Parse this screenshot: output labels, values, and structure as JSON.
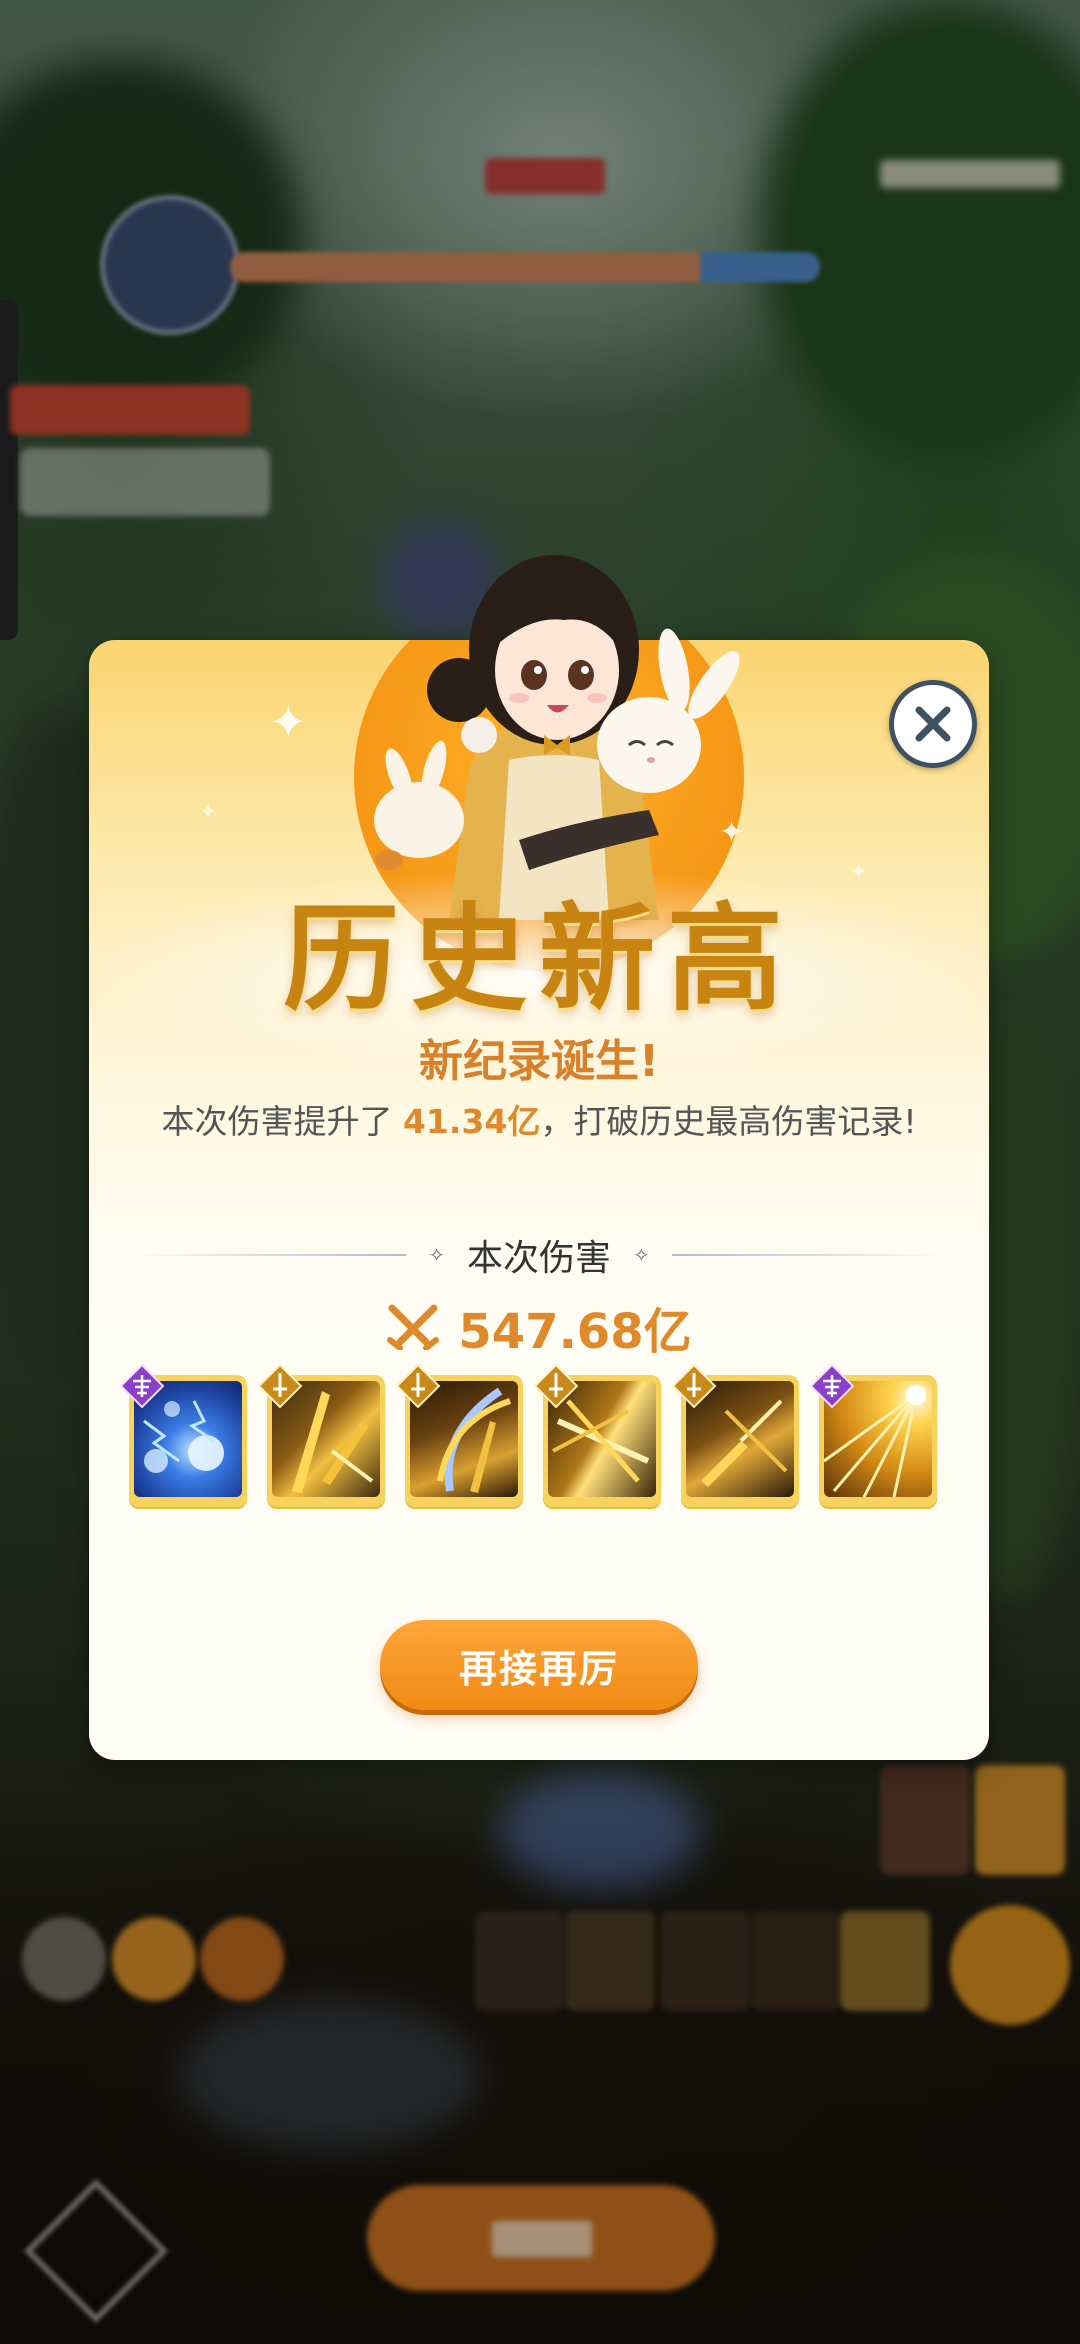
{
  "popup": {
    "title": "历史新高",
    "subtitle": "新纪录诞生!",
    "desc_prefix": "本次伤害提升了 ",
    "desc_value": "41.34亿",
    "desc_suffix": "，打破历史最高伤害记录!",
    "section_label": "本次伤害",
    "damage_value": "547.68亿",
    "again_button": "再接再厉",
    "close_icon": "close-icon"
  },
  "skills": [
    {
      "name": "lightning-orb-skill",
      "badge": "purple-shrine-badge",
      "color": "#2a6fe0"
    },
    {
      "name": "sword-strike-skill-1",
      "badge": "gold-sword-badge",
      "color": "#d49a20"
    },
    {
      "name": "sword-strike-skill-2",
      "badge": "gold-sword-badge",
      "color": "#c98b1e"
    },
    {
      "name": "sword-strike-skill-3",
      "badge": "gold-sword-badge",
      "color": "#d9a030"
    },
    {
      "name": "sword-strike-skill-4",
      "badge": "gold-sword-badge",
      "color": "#c99224"
    },
    {
      "name": "light-burst-skill",
      "badge": "purple-shrine-badge",
      "color": "#e8a520"
    }
  ],
  "colors": {
    "accent": "#e0892a",
    "title": "#c88410",
    "button": "#f08a14"
  }
}
